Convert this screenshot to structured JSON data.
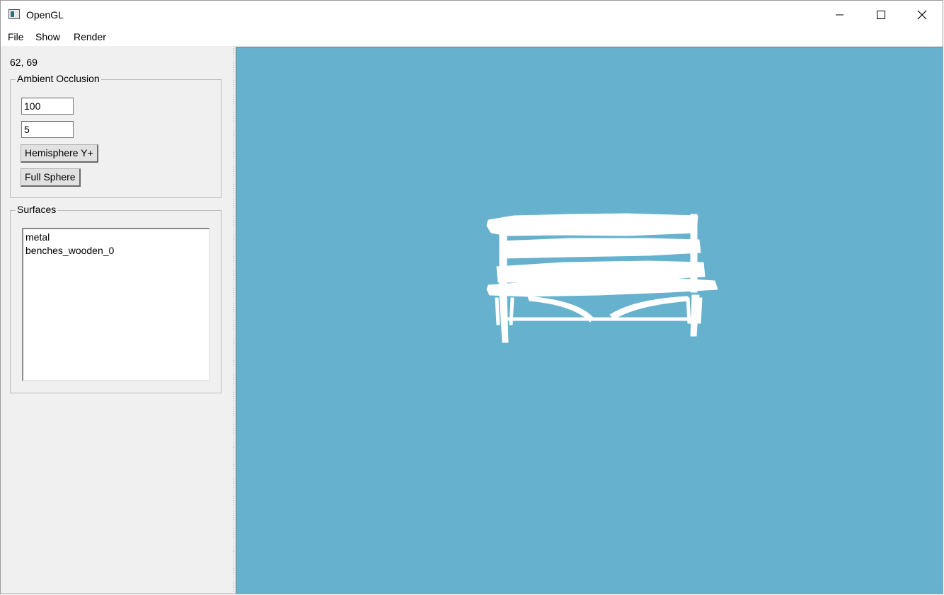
{
  "window": {
    "title": "OpenGL",
    "app_icon": "opengl-app-icon"
  },
  "menubar": {
    "items": [
      "File",
      "Show",
      "Render"
    ]
  },
  "left_panel": {
    "coords": "62, 69",
    "ambient_occlusion": {
      "title": "Ambient Occlusion",
      "field1_value": "100",
      "field2_value": "5",
      "hemisphere_button": "Hemisphere Y+",
      "full_sphere_button": "Full Sphere"
    },
    "surfaces": {
      "title": "Surfaces",
      "items": [
        "metal",
        "benches_wooden_0"
      ]
    }
  },
  "viewport": {
    "background_color": "#66b1cd",
    "model": "white-bench-silhouette",
    "model_color": "#ffffff"
  }
}
